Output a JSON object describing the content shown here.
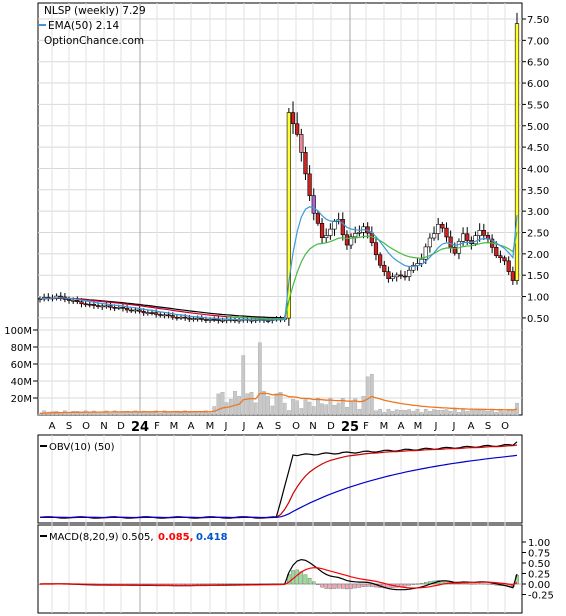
{
  "chart_data": [
    {
      "type": "candlestick",
      "panel": "price",
      "title": "NLSP (weekly) 7.29",
      "legend": [
        {
          "label": "EMA(50) 2.14",
          "color": "#3a9ad9"
        },
        {
          "label": "OptionChance.com",
          "color": null
        }
      ],
      "y_ticks": [
        "7.50",
        "7.00",
        "6.50",
        "6.00",
        "5.50",
        "5.00",
        "4.50",
        "4.00",
        "3.50",
        "3.00",
        "2.50",
        "2.00",
        "1.50",
        "1.00",
        "0.50"
      ],
      "ylim": [
        0.0,
        7.7
      ],
      "x_ticks": [
        "A",
        "S",
        "O",
        "N",
        "D",
        "24",
        "F",
        "M",
        "A",
        "M",
        "J",
        "J",
        "A",
        "S",
        "O",
        "N",
        "D",
        "25",
        "F",
        "M",
        "A",
        "M",
        "J",
        "J",
        "A",
        "S",
        "O"
      ],
      "key_points": [
        {
          "x": "2023-08",
          "close": 0.95
        },
        {
          "x": "2023-12",
          "close": 0.75
        },
        {
          "x": "2024-04",
          "close": 0.45
        },
        {
          "x": "2024-09",
          "close": 0.45
        },
        {
          "x": "2024-10",
          "close": 5.2
        },
        {
          "x": "2024-11",
          "close": 2.4
        },
        {
          "x": "2025-01",
          "close": 2.6
        },
        {
          "x": "2025-03",
          "close": 1.45
        },
        {
          "x": "2025-06",
          "close": 2.4
        },
        {
          "x": "2025-10",
          "close": 1.4
        },
        {
          "x": "2025-10 last",
          "close": 7.29
        }
      ],
      "ema50_color": "#3a9ad9",
      "ma_green_color": "#44bb44",
      "ma_black_color": "#000000",
      "ma_red_color": "#cc0033"
    },
    {
      "type": "bar",
      "panel": "volume",
      "y_ticks": [
        "100M",
        "80M",
        "60M",
        "40M",
        "20M"
      ],
      "ylim": [
        0,
        110
      ],
      "units": "M shares",
      "bar_color": "#c8c8c8",
      "avg_line_color": "#ee7722"
    },
    {
      "type": "line",
      "panel": "obv",
      "legend": "OBV(10) (50)",
      "series_colors": [
        "#000000",
        "#cc0000",
        "#0000cc"
      ]
    },
    {
      "type": "line",
      "panel": "macd",
      "legend_prefix": "MACD(8,20,9) 0.505,",
      "signal_value": "0.085,",
      "hist_value": "0.418",
      "signal_color": "#ff0000",
      "hist_color": "#0055cc",
      "y_ticks": [
        "1.00",
        "0.75",
        "0.50",
        "0.25",
        "0.00",
        "-0.25"
      ],
      "ylim": [
        -0.35,
        1.15
      ]
    }
  ]
}
